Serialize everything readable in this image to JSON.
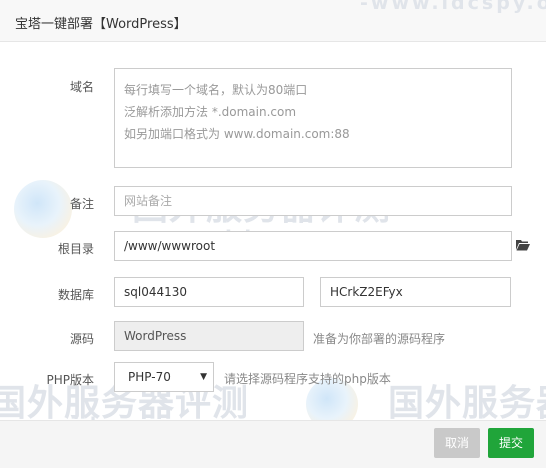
{
  "dialog": {
    "title": "宝塔一键部署【WordPress】"
  },
  "form": {
    "domain": {
      "label": "域名",
      "placeholder_lines": [
        "每行填写一个域名，默认为80端口",
        "泛解析添加方法 *.domain.com",
        "如另加端口格式为 www.domain.com:88"
      ]
    },
    "remark": {
      "label": "备注",
      "placeholder": "网站备注"
    },
    "root_dir": {
      "label": "根目录",
      "value": "/www/wwwroot",
      "browse_icon": "folder-open-icon"
    },
    "database": {
      "label": "数据库",
      "name_value": "sql044130",
      "password_value": "HCrkZ2EFyx"
    },
    "source": {
      "label": "源码",
      "value": "WordPress",
      "hint": "准备为你部署的源码程序"
    },
    "php_version": {
      "label": "PHP版本",
      "selected": "PHP-70",
      "hint": "请选择源码程序支持的php版本"
    }
  },
  "footer": {
    "cancel_label": "取消",
    "submit_label": "提交"
  },
  "watermark": {
    "text_cn": "国外服务器评测",
    "text_url": "-www.idcspy.org-"
  },
  "colors": {
    "submit": "#20a53a",
    "cancel": "#c9c9c9"
  }
}
